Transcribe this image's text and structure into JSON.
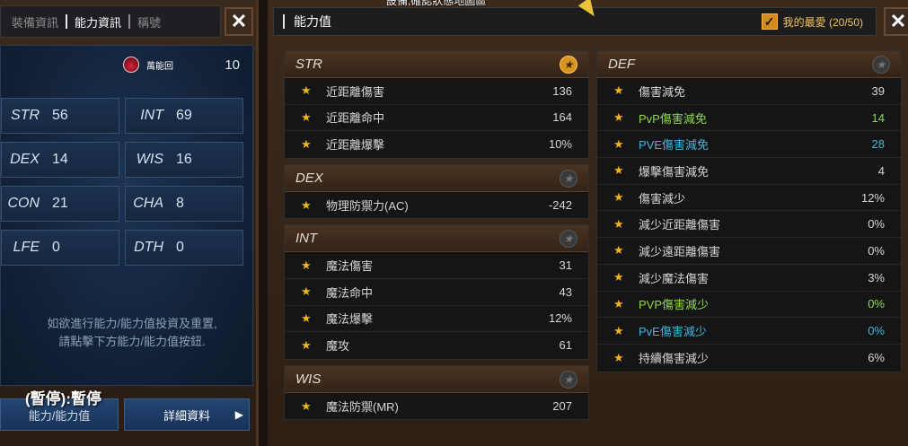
{
  "left_window": {
    "tabs": [
      "裝備資訊",
      "能力資訊",
      "稱號"
    ],
    "close_label": "✕",
    "bonus": {
      "label": "萬能回",
      "value": "10"
    },
    "stats": [
      {
        "name": "STR",
        "value": "56"
      },
      {
        "name": "INT",
        "value": "69"
      },
      {
        "name": "DEX",
        "value": "14"
      },
      {
        "name": "WIS",
        "value": "16"
      },
      {
        "name": "CON",
        "value": "21"
      },
      {
        "name": "CHA",
        "value": "8"
      },
      {
        "name": "LFE",
        "value": "0"
      },
      {
        "name": "DTH",
        "value": "0"
      }
    ],
    "hint_line1": "如欲進行能力/能力值投資及重置,",
    "hint_line2": "請點擊下方能力/能力值按鈕.",
    "pause_text": "(暫停):暫停",
    "ability_button": "能力/能力值",
    "detail_button": "詳細資料",
    "detail_arrow": "▶"
  },
  "right_window": {
    "title": "能力值",
    "favorites_label": "我的最愛 (20/50)",
    "favorites_check": "✓",
    "close_label": "✕",
    "top_overlay": "設備,確認狀態地圖區"
  },
  "sections_left": [
    {
      "title": "STR",
      "starred": true,
      "rows": [
        {
          "label": "近距離傷害",
          "value": "136",
          "color": "normal"
        },
        {
          "label": "近距離命中",
          "value": "164",
          "color": "normal"
        },
        {
          "label": "近距離爆擊",
          "value": "10%",
          "color": "normal"
        }
      ]
    },
    {
      "title": "DEX",
      "starred": false,
      "rows": [
        {
          "label": "物理防禦力(AC)",
          "value": "-242",
          "color": "normal"
        }
      ]
    },
    {
      "title": "INT",
      "starred": false,
      "rows": [
        {
          "label": "魔法傷害",
          "value": "31",
          "color": "normal"
        },
        {
          "label": "魔法命中",
          "value": "43",
          "color": "normal"
        },
        {
          "label": "魔法爆擊",
          "value": "12%",
          "color": "normal"
        },
        {
          "label": "魔攻",
          "value": "61",
          "color": "normal"
        }
      ]
    },
    {
      "title": "WIS",
      "starred": false,
      "rows": [
        {
          "label": "魔法防禦(MR)",
          "value": "207",
          "color": "normal"
        }
      ]
    }
  ],
  "section_def": {
    "title": "DEF",
    "starred": false,
    "rows": [
      {
        "label": "傷害減免",
        "value": "39",
        "color": "normal"
      },
      {
        "label": "PvP傷害減免",
        "value": "14",
        "color": "green"
      },
      {
        "label": "PVE傷害減免",
        "value": "28",
        "color": "blue"
      },
      {
        "label": "爆擊傷害減免",
        "value": "4",
        "color": "normal"
      },
      {
        "label": "傷害減少",
        "value": "12%",
        "color": "normal"
      },
      {
        "label": "減少近距離傷害",
        "value": "0%",
        "color": "normal"
      },
      {
        "label": "減少遠距離傷害",
        "value": "0%",
        "color": "normal"
      },
      {
        "label": "減少魔法傷害",
        "value": "3%",
        "color": "normal"
      },
      {
        "label": "PVP傷害減少",
        "value": "0%",
        "color": "green"
      },
      {
        "label": "PvE傷害減少",
        "value": "0%",
        "color": "blue"
      },
      {
        "label": "持續傷害減少",
        "value": "6%",
        "color": "normal"
      }
    ]
  },
  "icons": {
    "row_star": "★",
    "section_star": "★",
    "potion": "potion-icon",
    "cursor": "cursor-icon"
  },
  "colors": {
    "accent_gold": "#f2b31d",
    "pvp_green": "#8ed94c",
    "pve_blue": "#3fb6e0"
  }
}
